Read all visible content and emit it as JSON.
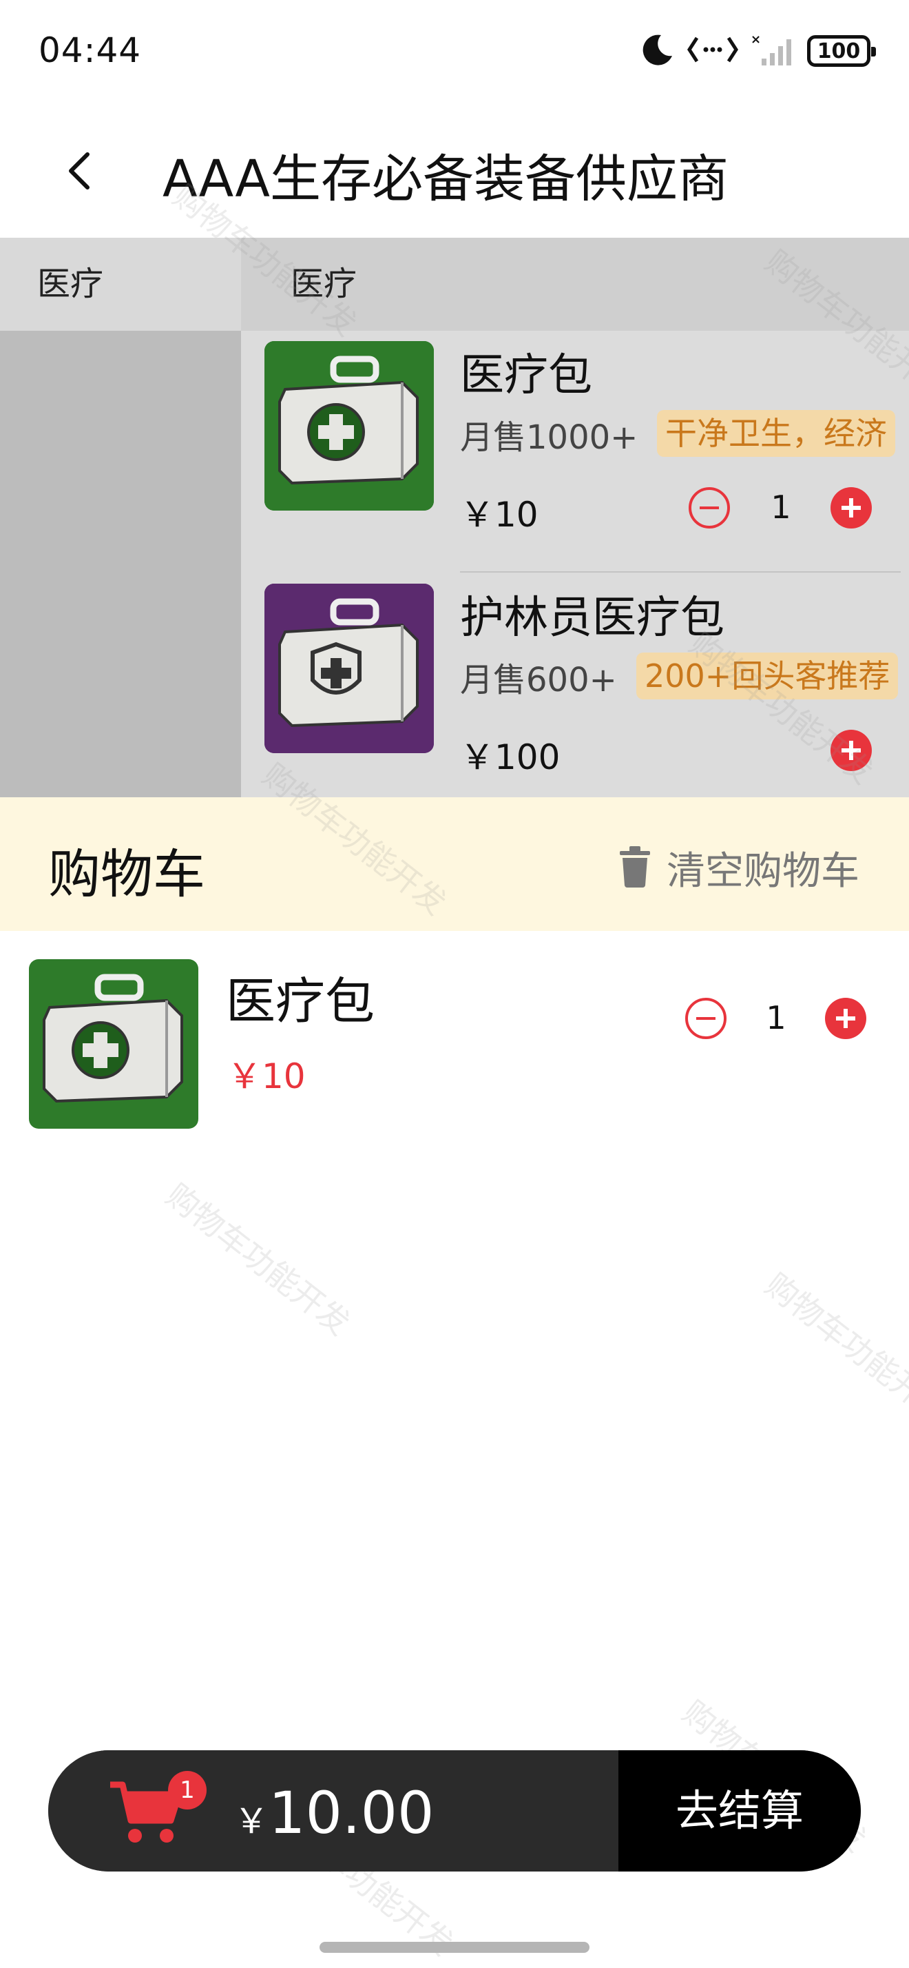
{
  "status_bar": {
    "time": "04:44",
    "battery": "100",
    "icons": [
      "moon-icon",
      "data-transfer-icon",
      "signal-icon",
      "battery-icon"
    ]
  },
  "header": {
    "title": "AAA生存必备装备供应商",
    "back_icon": "chevron-left-icon"
  },
  "menu": {
    "categories": [
      {
        "label": "医疗",
        "selected": true
      }
    ],
    "section_title": "医疗",
    "products": [
      {
        "name": "医疗包",
        "sales": "月售1000+",
        "tag": "干净卫生，经济",
        "price": "￥10",
        "quantity": "1",
        "image_color": "#2f7d2a"
      },
      {
        "name": "护林员医疗包",
        "sales": "月售600+",
        "tag": "200+回头客推荐",
        "price": "￥100",
        "image_color": "#5b2a6e"
      }
    ]
  },
  "cart": {
    "title": "购物车",
    "clear_label": "清空购物车",
    "items": [
      {
        "name": "医疗包",
        "price": "￥10",
        "quantity": "1"
      }
    ]
  },
  "checkout": {
    "badge_count": "1",
    "currency": "￥",
    "total": "10.00",
    "button_label": "去结算"
  },
  "watermark": "购物车功能开发",
  "colors": {
    "accent_red": "#e8343c",
    "tag_bg": "#f4d9a8",
    "tag_text": "#c9781c",
    "cart_header_bg": "#fef7df",
    "checkout_bg": "#2b2b2b"
  }
}
